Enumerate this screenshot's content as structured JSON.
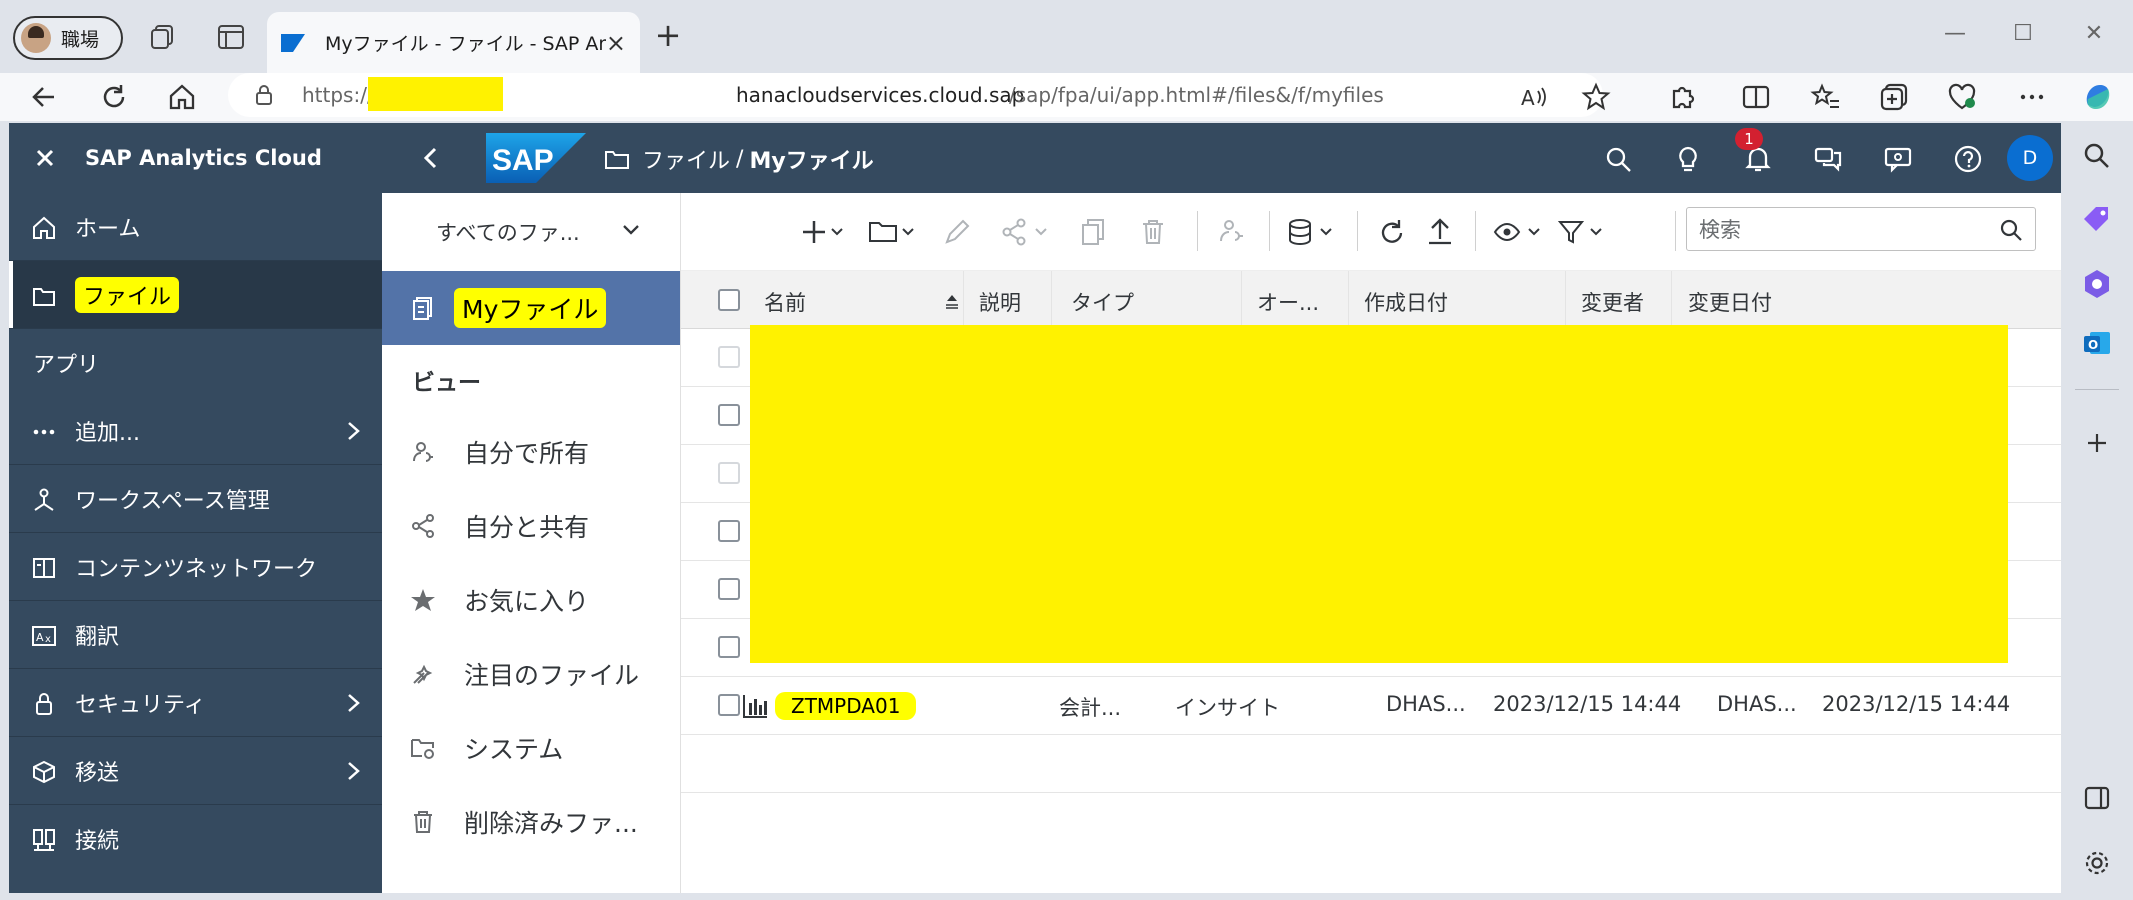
{
  "browser": {
    "profile_label": "職場",
    "tab_title": "Myファイル - ファイル - SAP Analytic",
    "url_prefix": "https://",
    "url_host": "hanacloudservices.cloud.sap",
    "url_path": "/sap/fpa/ui/app.html#/files&/f/myfiles"
  },
  "shell": {
    "app_title": "SAP Analytics Cloud",
    "logo_text": "SAP",
    "breadcrumb_root": "ファイル",
    "breadcrumb_sep": "/",
    "breadcrumb_current": "Myファイル",
    "notification_count": "1",
    "avatar_initial": "D"
  },
  "nav": {
    "items": [
      {
        "label": "ホーム",
        "icon": "home-icon"
      },
      {
        "label": "ファイル",
        "icon": "folder-icon"
      },
      {
        "label": "アプリ"
      },
      {
        "label": "追加...",
        "icon": "more-icon"
      },
      {
        "label": "ワークスペース管理",
        "icon": "workspace-icon"
      },
      {
        "label": "コンテンツネットワーク",
        "icon": "content-network-icon"
      },
      {
        "label": "翻訳",
        "icon": "translate-icon"
      },
      {
        "label": "セキュリティ",
        "icon": "lock-icon"
      },
      {
        "label": "移送",
        "icon": "transport-icon"
      },
      {
        "label": "接続",
        "icon": "connection-icon"
      }
    ]
  },
  "files_panel": {
    "filter_label": "すべてのファ...",
    "items": [
      {
        "label": "Myファイル"
      },
      {
        "label": "ビュー"
      },
      {
        "label": "自分で所有"
      },
      {
        "label": "自分と共有"
      },
      {
        "label": "お気に入り"
      },
      {
        "label": "注目のファイル"
      },
      {
        "label": "システム"
      },
      {
        "label": "削除済みファ..."
      }
    ]
  },
  "toolbar": {
    "search_placeholder": "検索"
  },
  "table": {
    "columns": [
      "名前",
      "説明",
      "タイプ",
      "オー...",
      "作成日付",
      "変更者",
      "変更日付"
    ],
    "rows": [
      {
        "name": "ZTMPDA01",
        "description": "会計...",
        "type": "インサイト",
        "owner": "DHAS...",
        "created": "2023/12/15 14:44",
        "changed_by": "DHAS...",
        "changed": "2023/12/15 14:44"
      }
    ]
  },
  "colors": {
    "shell": "#354a5f",
    "active_item": "#5373a8",
    "highlight": "#ffff00",
    "redaction": "#fff200",
    "badge": "#d32030",
    "avatar": "#0a6ed1"
  }
}
